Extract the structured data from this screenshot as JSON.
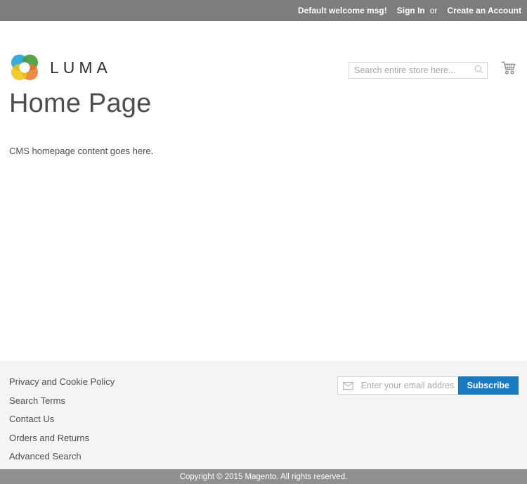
{
  "top_panel": {
    "welcome_message": "Default welcome msg!",
    "sign_in_label": "Sign In",
    "separator_label": "or",
    "create_account_label": "Create an Account"
  },
  "header": {
    "logo_word": "LUMA",
    "logo_icon": "luma-flower-logo",
    "search": {
      "placeholder": "Search entire store here...",
      "value": "",
      "icon": "search-icon"
    },
    "cart": {
      "icon": "shopping-cart-icon"
    }
  },
  "main": {
    "page_title": "Home Page",
    "cms_content": "CMS homepage content goes here."
  },
  "footer": {
    "links": [
      {
        "label": "Privacy and Cookie Policy"
      },
      {
        "label": "Search Terms"
      },
      {
        "label": "Contact Us"
      },
      {
        "label": "Orders and Returns"
      },
      {
        "label": "Advanced Search"
      }
    ],
    "newsletter": {
      "icon": "envelope-icon",
      "placeholder": "Enter your email address",
      "value": "",
      "subscribe_label": "Subscribe"
    }
  },
  "copyright": {
    "text": "Copyright © 2015 Magento. All rights reserved."
  },
  "colors": {
    "top_panel_bg": "#7d7d7d",
    "footer_bg": "#f4f4f4",
    "copyright_bg": "#8f8f8f",
    "accent_blue": "#1979c3",
    "logo_blue": "#3aa9dc",
    "logo_green": "#4a9b3a",
    "logo_orange": "#e8762c",
    "logo_yellow": "#f2c20b"
  }
}
